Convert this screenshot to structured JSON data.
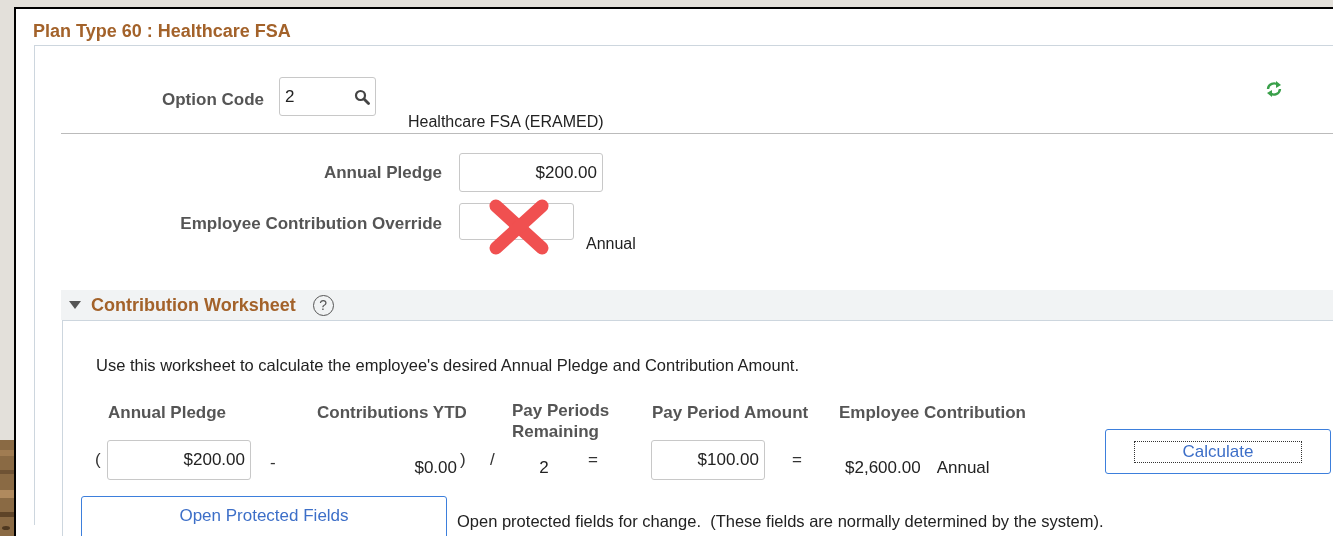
{
  "panel": {
    "title": "Plan Type 60 : Healthcare FSA"
  },
  "option_code": {
    "label": "Option Code",
    "value": "2",
    "description": "Healthcare FSA (ERAMED)"
  },
  "annual_pledge": {
    "label": "Annual Pledge",
    "value": "$200.00"
  },
  "employee_contribution_override": {
    "label": "Employee Contribution Override",
    "unit": "Annual"
  },
  "worksheet": {
    "title": "Contribution Worksheet",
    "expanded": true,
    "help": "?",
    "instructions": "Use this worksheet to calculate the employee's desired Annual Pledge and Contribution Amount.",
    "columns": [
      "Annual Pledge",
      "Contributions YTD",
      "Pay Periods Remaining",
      "Pay Period Amount",
      "Employee Contribution"
    ],
    "row": [
      {
        "kind": "symbol",
        "text": "("
      },
      {
        "kind": "input",
        "text": "$200.00"
      },
      {
        "kind": "symbol",
        "text": "-"
      },
      {
        "kind": "value",
        "text": "$0.00"
      },
      {
        "kind": "symbol",
        "text": ")"
      },
      {
        "kind": "symbol",
        "text": "/"
      },
      {
        "kind": "value",
        "text": "2"
      },
      {
        "kind": "symbol",
        "text": "="
      },
      {
        "kind": "input",
        "text": "$100.00"
      },
      {
        "kind": "symbol",
        "text": "="
      },
      {
        "kind": "value",
        "text": "$2,600.00"
      },
      {
        "kind": "value",
        "text": "Annual"
      }
    ],
    "calculate_button": {
      "label": "Calculate",
      "focused": true
    },
    "open_button": "Open Protected Fields",
    "open_note": "Open protected fields for change.  (These fields are normally determined by the system)."
  }
}
